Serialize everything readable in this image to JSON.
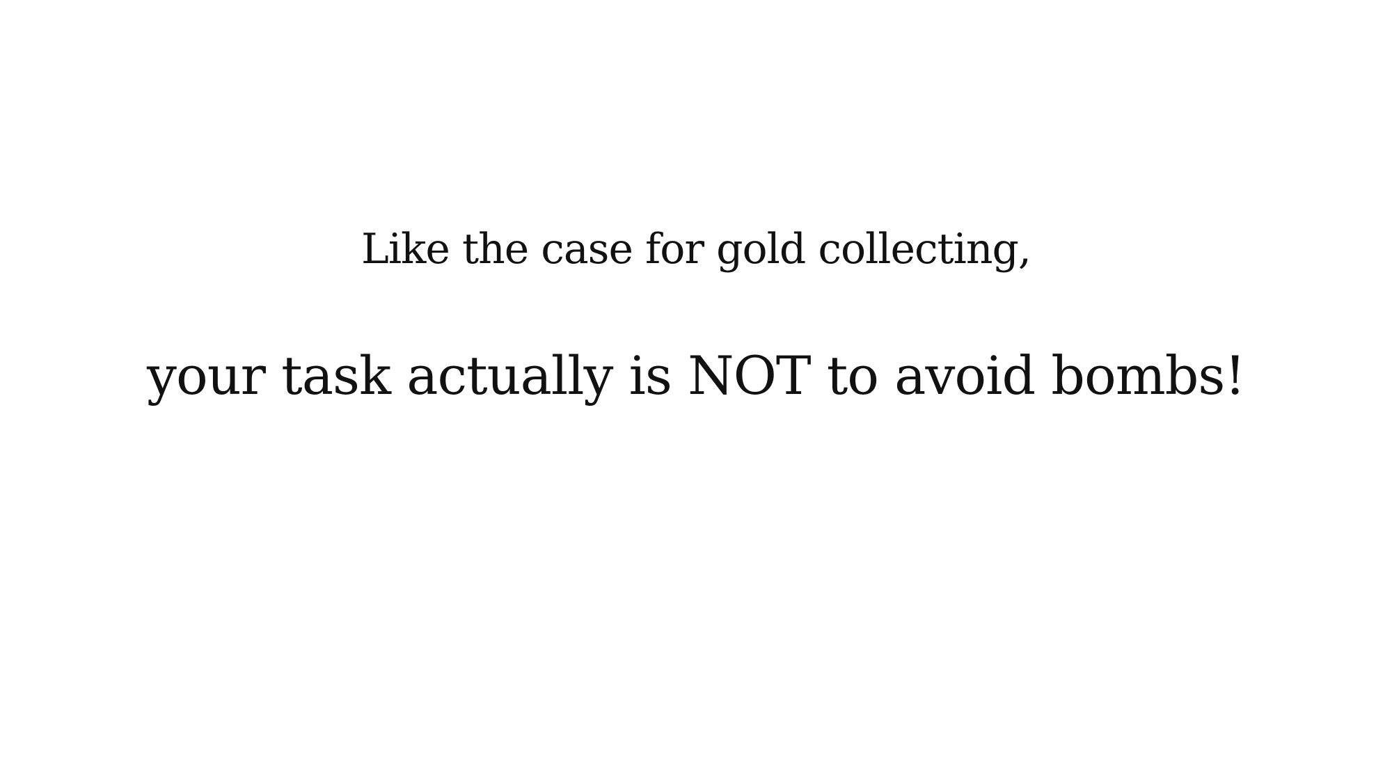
{
  "slide": {
    "line1": "Like the case for gold collecting,",
    "line2": "your task actually is NOT to avoid bombs!"
  },
  "colors": {
    "background": "#ffffff",
    "text": "#111111"
  }
}
